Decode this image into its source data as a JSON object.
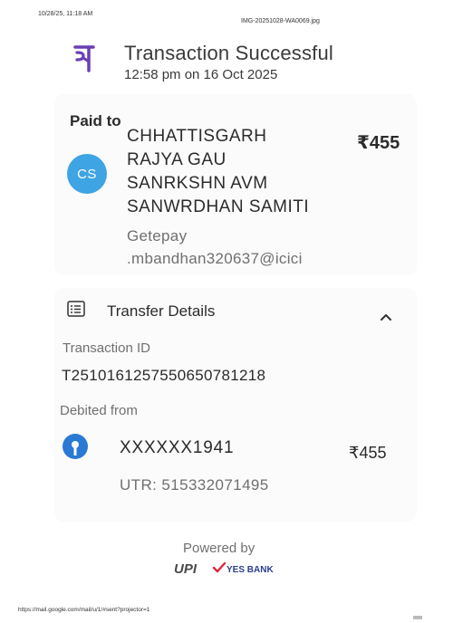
{
  "print_header": {
    "datetime": "10/28/25, 11:18 AM",
    "file_name": "IMG-20251028-WA0069.jpg"
  },
  "print_footer": {
    "url": "https://mail.google.com/mail/u/1/#sent?projector=1"
  },
  "header": {
    "logo_icon": "phonepe-logo-icon",
    "logo_color": "#6a3fb5",
    "title": "Transaction Successful",
    "datetime": "12:58 pm on 16 Oct 2025"
  },
  "payee": {
    "label": "Paid to",
    "name_lines": [
      "CHHATTISGARH",
      "RAJYA GAU",
      "SANRKSHN AVM",
      "SANWRDHAN SAMITI"
    ],
    "amount": "₹455",
    "avatar_initials": "CS",
    "avatar_color": "#3fa4e3",
    "upi_lines": [
      "Getepay",
      ".mbandhan320637@icici"
    ]
  },
  "transfer": {
    "title": "Transfer Details",
    "section_icon": "receipt-list-icon",
    "toggle_icon": "chevron-up-icon",
    "transaction_id_label": "Transaction ID",
    "transaction_id": "T2510161257550650781218",
    "debited_label": "Debited from",
    "bank_icon": "sbi-bank-icon",
    "account": "XXXXXX1941",
    "amount": "₹455",
    "utr": "UTR: 515332071495"
  },
  "footer": {
    "powered_by": "Powered by",
    "upi_text": "UPI",
    "bank_text": "YES BANK"
  }
}
